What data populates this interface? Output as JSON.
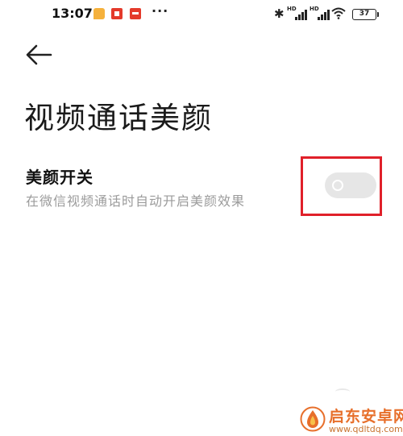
{
  "status_bar": {
    "time": "13:07",
    "more": "···",
    "battery": "37",
    "signal_tag": "HD"
  },
  "header": {
    "title": "视频通话美颜"
  },
  "setting": {
    "title": "美颜开关",
    "description": "在微信视频通话时自动开启美颜效果",
    "enabled": false
  },
  "watermark": {
    "name": "启东安卓网",
    "url": "www.qdltdq.com"
  },
  "colors": {
    "toggle_off": "#e6e6e6",
    "highlight": "#e0202a",
    "watermark": "#e76f2b",
    "description": "#9b9b9b"
  }
}
